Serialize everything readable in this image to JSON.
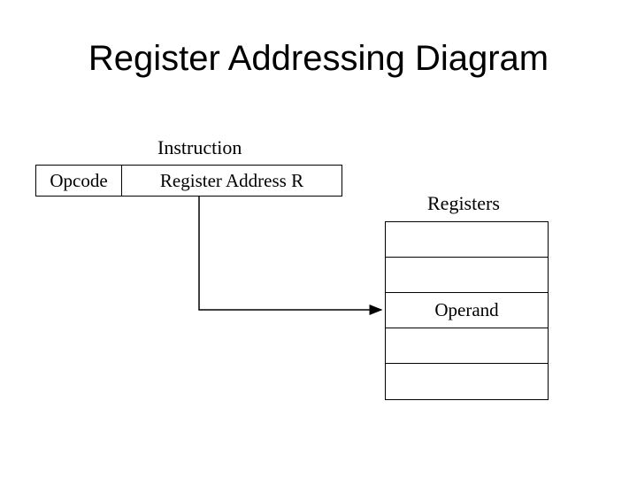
{
  "title": "Register Addressing Diagram",
  "instruction_label": "Instruction",
  "instruction": {
    "opcode": "Opcode",
    "register_address": "Register Address R"
  },
  "registers_label": "Registers",
  "registers": {
    "cells": [
      "",
      "",
      "Operand",
      "",
      ""
    ]
  }
}
